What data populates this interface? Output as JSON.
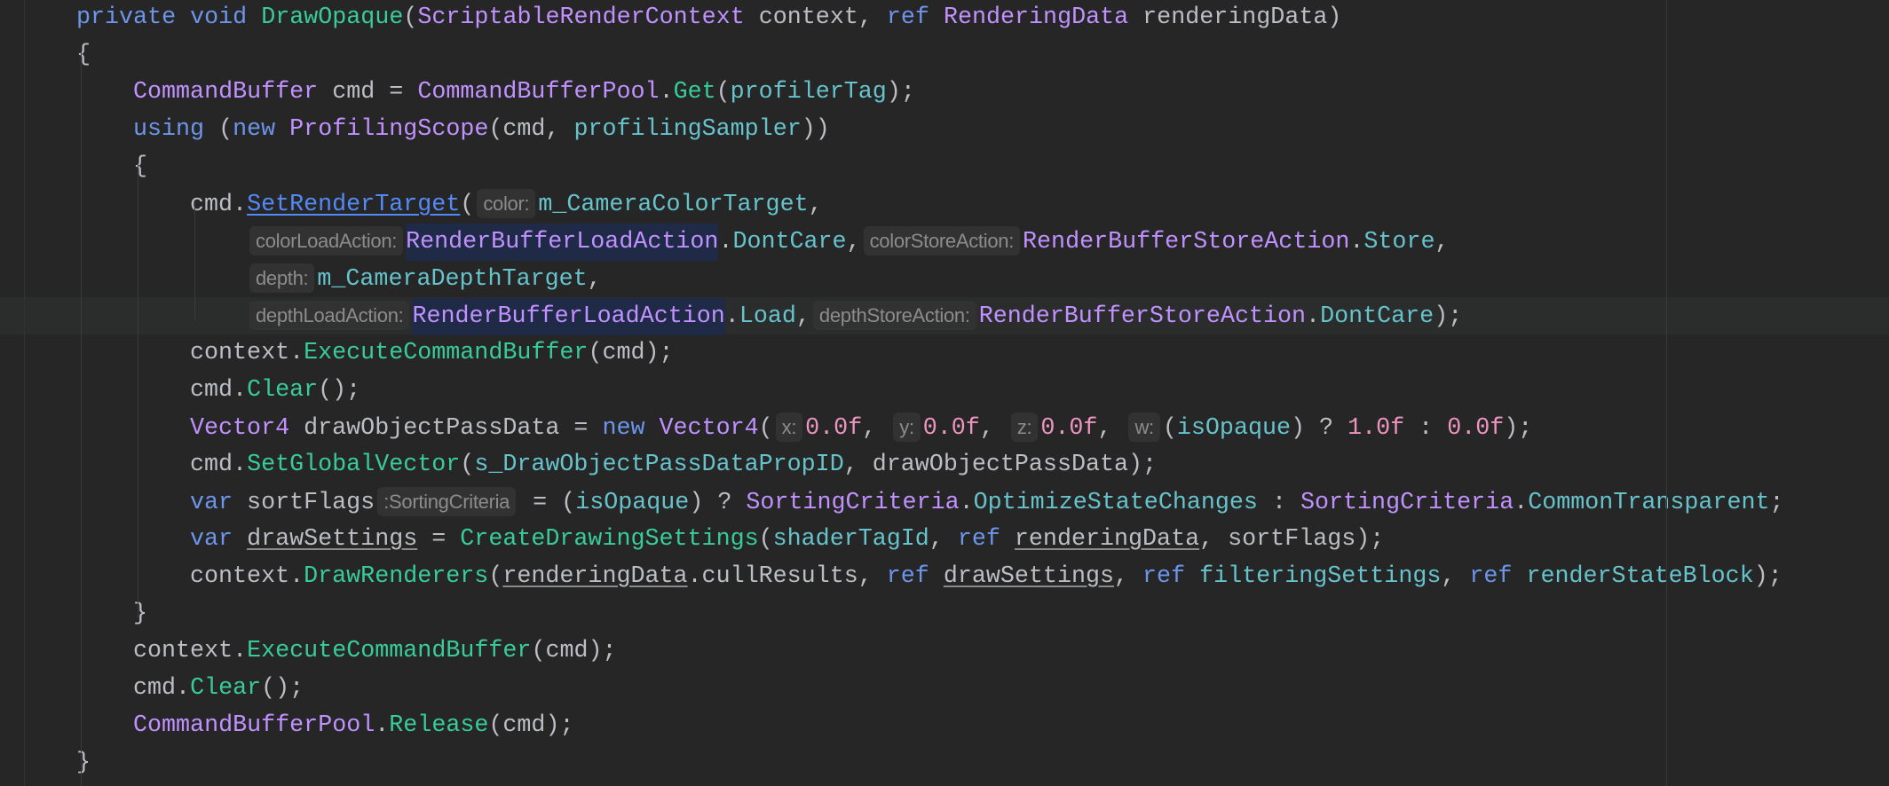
{
  "colors": {
    "background": "#262626",
    "keyword": "#6c95eb",
    "method": "#39cc9b",
    "type": "#c191ff",
    "field": "#66c3cc",
    "number": "#ed94c0",
    "hint": "#8c8c8c"
  },
  "code": {
    "current_line": 8,
    "lines": [
      {
        "indent": 1,
        "tokens": [
          [
            "private",
            "k"
          ],
          [
            " ",
            "p"
          ],
          [
            "void",
            "k"
          ],
          [
            " ",
            "p"
          ],
          [
            "DrawOpaque",
            "m"
          ],
          [
            "(",
            "p"
          ],
          [
            "ScriptableRenderContext",
            "t"
          ],
          [
            " context, ",
            "p"
          ],
          [
            "ref",
            "k"
          ],
          [
            " ",
            "p"
          ],
          [
            "RenderingData",
            "t"
          ],
          [
            " renderingData)",
            "p"
          ]
        ]
      },
      {
        "indent": 1,
        "tokens": [
          [
            "{",
            "p"
          ]
        ]
      },
      {
        "indent": 2,
        "tokens": [
          [
            "CommandBuffer",
            "t"
          ],
          [
            " cmd = ",
            "p"
          ],
          [
            "CommandBufferPool",
            "t"
          ],
          [
            ".",
            "p"
          ],
          [
            "Get",
            "m"
          ],
          [
            "(",
            "p"
          ],
          [
            "profilerTag",
            "f"
          ],
          [
            ");",
            "p"
          ]
        ]
      },
      {
        "indent": 2,
        "tokens": [
          [
            "using",
            "k"
          ],
          [
            " (",
            "p"
          ],
          [
            "new",
            "k"
          ],
          [
            " ",
            "p"
          ],
          [
            "ProfilingScope",
            "t"
          ],
          [
            "(cmd, ",
            "p"
          ],
          [
            "profilingSampler",
            "f"
          ],
          [
            "))",
            "p"
          ]
        ]
      },
      {
        "indent": 2,
        "tokens": [
          [
            "{",
            "p"
          ]
        ]
      },
      {
        "indent": 3,
        "tokens": [
          [
            "cmd.",
            "p"
          ],
          [
            "SetRenderTarget",
            "l"
          ],
          [
            "(",
            "p"
          ],
          [
            "color:",
            "h"
          ],
          [
            "m_CameraColorTarget",
            "f"
          ],
          [
            ",",
            "p"
          ]
        ]
      },
      {
        "indent": 4,
        "tokens": [
          [
            "colorLoadAction:",
            "h"
          ],
          [
            "RenderBufferLoadAction",
            "hl"
          ],
          [
            ".",
            "p"
          ],
          [
            "DontCare",
            "f"
          ],
          [
            ",",
            "p"
          ],
          [
            "colorStoreAction:",
            "h"
          ],
          [
            "RenderBufferStoreAction",
            "t"
          ],
          [
            ".",
            "p"
          ],
          [
            "Store",
            "f"
          ],
          [
            ",",
            "p"
          ]
        ]
      },
      {
        "indent": 4,
        "tokens": [
          [
            "depth:",
            "h"
          ],
          [
            "m_CameraDepthTarget",
            "f"
          ],
          [
            ",",
            "p"
          ]
        ]
      },
      {
        "indent": 4,
        "tokens": [
          [
            "depthLoadAction:",
            "h"
          ],
          [
            "RenderBufferLoadAction",
            "hl"
          ],
          [
            ".",
            "p"
          ],
          [
            "Load",
            "f"
          ],
          [
            ",",
            "p"
          ],
          [
            "depthStoreAction:",
            "h"
          ],
          [
            "RenderBufferStoreAction",
            "t"
          ],
          [
            ".",
            "p"
          ],
          [
            "DontCare",
            "f"
          ],
          [
            ");",
            "p"
          ]
        ]
      },
      {
        "indent": 3,
        "tokens": [
          [
            "context.",
            "p"
          ],
          [
            "ExecuteCommandBuffer",
            "m"
          ],
          [
            "(cmd);",
            "p"
          ]
        ]
      },
      {
        "indent": 3,
        "tokens": [
          [
            "cmd.",
            "p"
          ],
          [
            "Clear",
            "m"
          ],
          [
            "();",
            "p"
          ]
        ]
      },
      {
        "indent": 3,
        "tokens": [
          [
            "Vector4",
            "t"
          ],
          [
            " drawObjectPassData = ",
            "p"
          ],
          [
            "new",
            "k"
          ],
          [
            " ",
            "p"
          ],
          [
            "Vector4",
            "t"
          ],
          [
            "(",
            "p"
          ],
          [
            "x:",
            "h"
          ],
          [
            "0.0f",
            "n"
          ],
          [
            ", ",
            "p"
          ],
          [
            "y:",
            "h"
          ],
          [
            "0.0f",
            "n"
          ],
          [
            ", ",
            "p"
          ],
          [
            "z:",
            "h"
          ],
          [
            "0.0f",
            "n"
          ],
          [
            ", ",
            "p"
          ],
          [
            "w:",
            "h"
          ],
          [
            "(",
            "p"
          ],
          [
            "isOpaque",
            "f"
          ],
          [
            ") ? ",
            "p"
          ],
          [
            "1.0f",
            "n"
          ],
          [
            " : ",
            "p"
          ],
          [
            "0.0f",
            "n"
          ],
          [
            ");",
            "p"
          ]
        ]
      },
      {
        "indent": 3,
        "tokens": [
          [
            "cmd.",
            "p"
          ],
          [
            "SetGlobalVector",
            "m"
          ],
          [
            "(",
            "p"
          ],
          [
            "s_DrawObjectPassDataPropID",
            "f"
          ],
          [
            ", drawObjectPassData);",
            "p"
          ]
        ]
      },
      {
        "indent": 3,
        "tokens": [
          [
            "var",
            "k"
          ],
          [
            " sortFlags",
            "p"
          ],
          [
            ":SortingCriteria",
            "h"
          ],
          [
            " = (",
            "p"
          ],
          [
            "isOpaque",
            "f"
          ],
          [
            ") ? ",
            "p"
          ],
          [
            "SortingCriteria",
            "t"
          ],
          [
            ".",
            "p"
          ],
          [
            "OptimizeStateChanges",
            "f"
          ],
          [
            " : ",
            "p"
          ],
          [
            "SortingCriteria",
            "t"
          ],
          [
            ".",
            "p"
          ],
          [
            "CommonTransparent",
            "f"
          ],
          [
            ";",
            "p"
          ]
        ]
      },
      {
        "indent": 3,
        "tokens": [
          [
            "var",
            "k"
          ],
          [
            " ",
            "p"
          ],
          [
            "drawSettings",
            "u"
          ],
          [
            " = ",
            "p"
          ],
          [
            "CreateDrawingSettings",
            "m"
          ],
          [
            "(",
            "p"
          ],
          [
            "shaderTagId",
            "f"
          ],
          [
            ", ",
            "p"
          ],
          [
            "ref",
            "k"
          ],
          [
            " ",
            "p"
          ],
          [
            "renderingData",
            "u"
          ],
          [
            ", sortFlags);",
            "p"
          ]
        ]
      },
      {
        "indent": 3,
        "tokens": [
          [
            "context.",
            "p"
          ],
          [
            "DrawRenderers",
            "m"
          ],
          [
            "(",
            "p"
          ],
          [
            "renderingData",
            "u"
          ],
          [
            ".cullResults, ",
            "p"
          ],
          [
            "ref",
            "k"
          ],
          [
            " ",
            "p"
          ],
          [
            "drawSettings",
            "u"
          ],
          [
            ", ",
            "p"
          ],
          [
            "ref",
            "k"
          ],
          [
            " ",
            "p"
          ],
          [
            "filteringSettings",
            "f"
          ],
          [
            ", ",
            "p"
          ],
          [
            "ref",
            "k"
          ],
          [
            " ",
            "p"
          ],
          [
            "renderStateBlock",
            "f"
          ],
          [
            ");",
            "p"
          ]
        ]
      },
      {
        "indent": 2,
        "tokens": [
          [
            "}",
            "p"
          ]
        ]
      },
      {
        "indent": 2,
        "tokens": [
          [
            "context.",
            "p"
          ],
          [
            "ExecuteCommandBuffer",
            "m"
          ],
          [
            "(cmd);",
            "p"
          ]
        ]
      },
      {
        "indent": 2,
        "tokens": [
          [
            "cmd.",
            "p"
          ],
          [
            "Clear",
            "m"
          ],
          [
            "();",
            "p"
          ]
        ]
      },
      {
        "indent": 2,
        "tokens": [
          [
            "CommandBufferPool",
            "t"
          ],
          [
            ".",
            "p"
          ],
          [
            "Release",
            "m"
          ],
          [
            "(cmd);",
            "p"
          ]
        ]
      },
      {
        "indent": 1,
        "tokens": [
          [
            "}",
            "p"
          ]
        ]
      }
    ]
  }
}
